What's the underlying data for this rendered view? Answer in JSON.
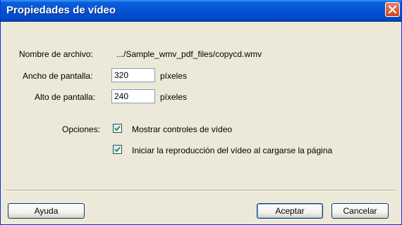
{
  "window": {
    "title": "Propiedades de vídeo"
  },
  "file": {
    "label": "Nombre de archivo:",
    "value": ".../Sample_wmv_pdf_files/copycd.wmv"
  },
  "width": {
    "label": "Ancho de pantalla:",
    "value": "320",
    "unit": "píxeles"
  },
  "height": {
    "label": "Alto de pantalla:",
    "value": "240",
    "unit": "píxeles"
  },
  "options": {
    "label": "Opciones:",
    "show_controls": {
      "label": "Mostrar controles de vídeo",
      "checked": true
    },
    "autoplay": {
      "label": "Iniciar la reproducción del vídeo al cargarse la página",
      "checked": true
    }
  },
  "buttons": {
    "help": "Ayuda",
    "ok": "Aceptar",
    "cancel": "Cancelar"
  },
  "icons": {
    "close": "close-icon",
    "check": "checkmark-icon"
  },
  "colors": {
    "titlebar": "#0553d5",
    "close": "#d3421b",
    "check": "#21a121",
    "background": "#ece9d8"
  }
}
